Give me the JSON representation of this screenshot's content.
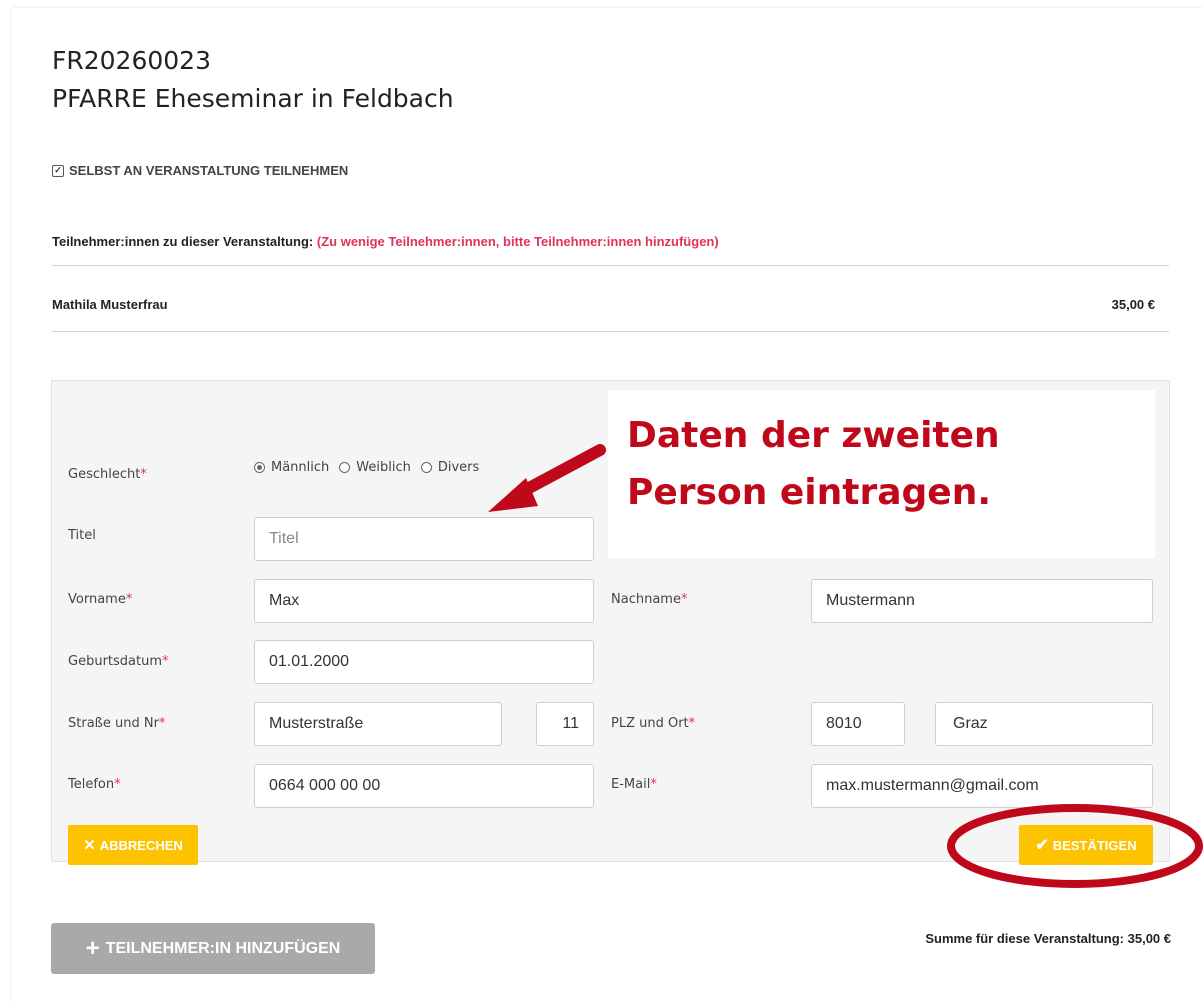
{
  "header": {
    "code": "FR20260023",
    "event_title": "PFARRE Eheseminar in Feldbach"
  },
  "self_participate": {
    "label": "SELBST AN VERANSTALTUNG TEILNEHMEN",
    "checked": true
  },
  "participants": {
    "label": "Teilnehmer:innen zu dieser Veranstaltung:",
    "warning": "(Zu wenige Teilnehmer:innen, bitte Teilnehmer:innen hinzufügen)",
    "rows": [
      {
        "name": "Mathila Musterfrau",
        "price": "35,00 €"
      }
    ]
  },
  "form": {
    "gender": {
      "label": "Geschlecht",
      "options": [
        "Männlich",
        "Weiblich",
        "Divers"
      ],
      "selected": "Männlich"
    },
    "title": {
      "label": "Titel",
      "placeholder": "Titel",
      "value": ""
    },
    "firstname": {
      "label": "Vorname",
      "value": "Max"
    },
    "lastname": {
      "label": "Nachname",
      "value": "Mustermann"
    },
    "birthdate": {
      "label": "Geburtsdatum",
      "value": "01.01.2000"
    },
    "street": {
      "label": "Straße und Nr",
      "value": "Musterstraße",
      "number": "11"
    },
    "city": {
      "label": "PLZ und Ort",
      "zip": "8010",
      "city": "Graz"
    },
    "phone": {
      "label": "Telefon",
      "value": "0664 000 00 00"
    },
    "email": {
      "label": "E-Mail",
      "value": "max.mustermann@gmail.com"
    },
    "required_marker": "*",
    "cancel_label": "ABBRECHEN",
    "confirm_label": "BESTÄTIGEN"
  },
  "annotation": {
    "note": "Daten der zweiten Person eintragen.",
    "color": "#c0081b"
  },
  "footer": {
    "add_label": "TEILNEHMER:IN HINZUFÜGEN",
    "sum_text": "Summe für diese Veranstaltung: 35,00 €"
  },
  "colors": {
    "accent": "#fdc300",
    "warning": "#e0335a",
    "disabled": "#a9a9a9"
  }
}
